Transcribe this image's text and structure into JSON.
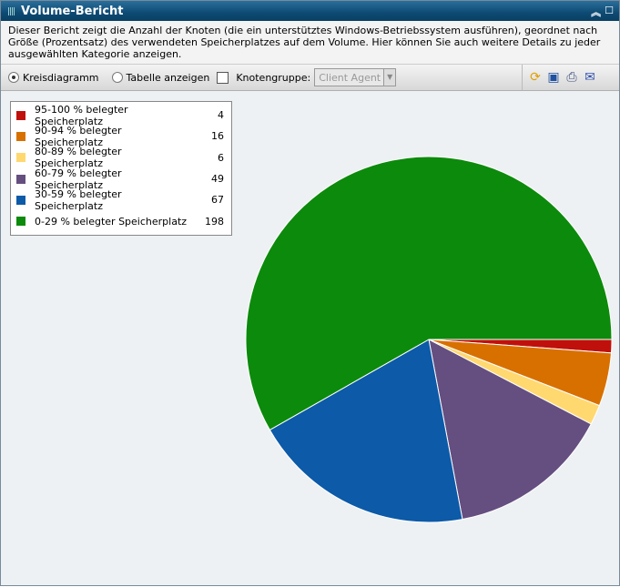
{
  "window": {
    "title": "Volume-Bericht",
    "description": "Dieser Bericht zeigt die Anzahl der Knoten (die ein unterstütztes Windows-Betriebssystem ausführen), geordnet nach Größe (Prozentsatz) des verwendeten Speicherplatzes auf dem Volume. Hier können Sie auch weitere Details zu jeder ausgewählten Kategorie anzeigen."
  },
  "toolbar": {
    "pie_label": "Kreisdiagramm",
    "table_label": "Tabelle anzeigen",
    "nodegroup_label": "Knotengruppe:",
    "nodegroup_value": "Client Agent"
  },
  "chart_data": {
    "type": "pie",
    "legend": "top-left",
    "categories": [
      "95-100 % belegter Speicherplatz",
      "90-94 % belegter Speicherplatz",
      "80-89 % belegter Speicherplatz",
      "60-79 % belegter Speicherplatz",
      "30-59 % belegter Speicherplatz",
      "0-29 % belegter Speicherplatz"
    ],
    "values": [
      4,
      16,
      6,
      49,
      67,
      198
    ],
    "colors": [
      "#c0100c",
      "#d87000",
      "#ffd870",
      "#654e80",
      "#0c5aa8",
      "#0c8a0c"
    ]
  }
}
